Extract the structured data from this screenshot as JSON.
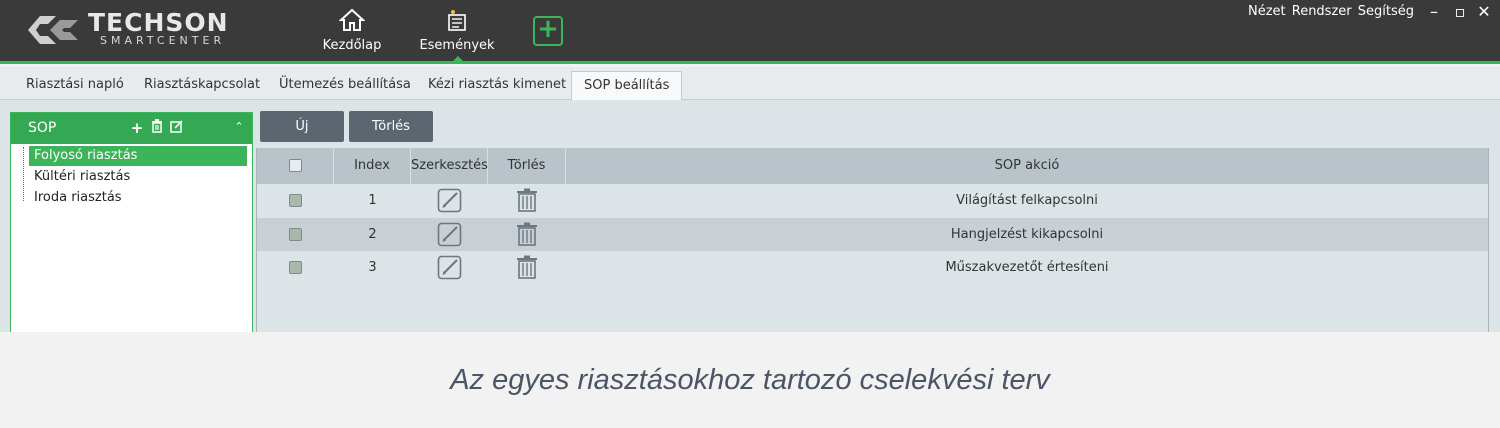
{
  "app": {
    "logo_text": "TECHSON",
    "logo_subtext": "SMARTCENTER",
    "nav": [
      {
        "label": "Kezdőlap",
        "icon": "home-icon"
      },
      {
        "label": "Események",
        "icon": "events-icon"
      }
    ],
    "add_icon": "plus-icon",
    "system_menu": "Nézet Rendszer Segítség",
    "window_controls": [
      "minimize-icon",
      "maximize-icon",
      "close-icon"
    ]
  },
  "tabs": [
    {
      "label": "Riasztási napló",
      "active": false
    },
    {
      "label": "Riasztáskapcsolat",
      "active": false
    },
    {
      "label": "Ütemezés beállítása",
      "active": false
    },
    {
      "label": "Kézi riasztás kimenet",
      "active": false
    },
    {
      "label": "SOP beállítás",
      "active": true
    }
  ],
  "sop_panel": {
    "title": "SOP",
    "tools": [
      "plus-icon",
      "trash-icon",
      "edit-icon",
      "chevron-up-icon"
    ],
    "items": [
      {
        "label": "Folyosó riasztás",
        "selected": true
      },
      {
        "label": "Kültéri riasztás",
        "selected": false
      },
      {
        "label": "Iroda riasztás",
        "selected": false
      }
    ]
  },
  "toolbar": {
    "new_label": "Új",
    "delete_label": "Törlés"
  },
  "table": {
    "headers": {
      "index": "Index",
      "edit": "Szerkesztés",
      "delete": "Törlés",
      "action": "SOP akció"
    },
    "rows": [
      {
        "index": "1",
        "action": "Világítást felkapcsolni"
      },
      {
        "index": "2",
        "action": "Hangjelzést kikapcsolni"
      },
      {
        "index": "3",
        "action": "Műszakvezetőt értesíteni"
      }
    ]
  },
  "caption": "Az egyes riasztásokhoz tartozó cselekvési terv",
  "colors": {
    "titlebar": "#3a3a3a",
    "accent_green": "#3cb55a",
    "button": "#5b6670",
    "table_header": "#b9c3ca"
  }
}
